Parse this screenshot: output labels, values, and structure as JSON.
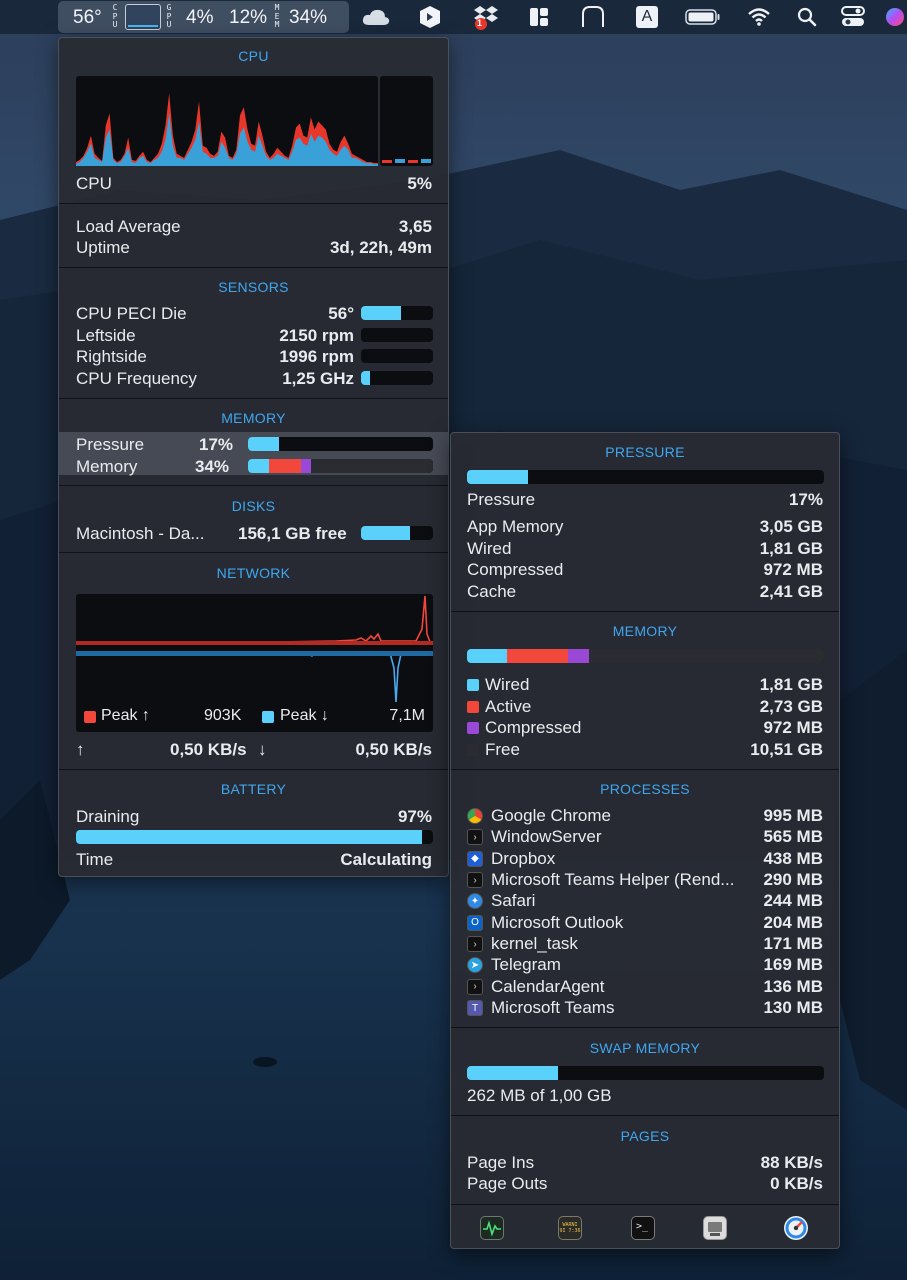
{
  "menubar": {
    "temperature": "56°",
    "cpu_vert_label": "C\nP\nU",
    "gpu_vert_label": "G\nP\nU",
    "gpu_percent": "4%",
    "cpu_percent": "12%",
    "mem_vert_label": "M\nE\nM",
    "mem_percent": "34%",
    "icons": [
      "cloud-icon",
      "dropzone-icon",
      "dropbox-icon",
      "rectangle-layout-icon",
      "dock-tab-icon",
      "input-source-icon",
      "battery-icon",
      "wifi-icon",
      "spotlight-search-icon",
      "control-center-icon",
      "siri-icon"
    ],
    "input_source_letter": "A",
    "badge_count": "1"
  },
  "cpu": {
    "title": "CPU",
    "label": "CPU",
    "value": "5%",
    "load_average_label": "Load Average",
    "load_average": "3,65",
    "uptime_label": "Uptime",
    "uptime": "3d, 22h, 49m",
    "graph_series": {
      "system": [
        4,
        6,
        10,
        18,
        30,
        12,
        8,
        5,
        40,
        52,
        8,
        4,
        6,
        12,
        28,
        6,
        5,
        10,
        14,
        6,
        4,
        8,
        12,
        22,
        40,
        72,
        30,
        12,
        10,
        8,
        16,
        24,
        36,
        64,
        20,
        18,
        12,
        10,
        14,
        34,
        28,
        10,
        8,
        16,
        50,
        58,
        36,
        22,
        20,
        44,
        30,
        14,
        8,
        12,
        18,
        14,
        10,
        8,
        20,
        38,
        42,
        30,
        28,
        48,
        36,
        44,
        40,
        36,
        22,
        16,
        14,
        24,
        30,
        22,
        12,
        10,
        8,
        6,
        4,
        4,
        3,
        3
      ],
      "user": [
        2,
        4,
        8,
        14,
        22,
        8,
        6,
        4,
        28,
        36,
        6,
        3,
        4,
        10,
        18,
        4,
        3,
        8,
        10,
        4,
        3,
        6,
        8,
        14,
        26,
        52,
        20,
        8,
        8,
        6,
        12,
        18,
        26,
        44,
        14,
        12,
        8,
        8,
        10,
        24,
        18,
        8,
        6,
        12,
        32,
        38,
        24,
        16,
        14,
        30,
        20,
        10,
        6,
        8,
        12,
        10,
        8,
        6,
        14,
        26,
        28,
        22,
        20,
        32,
        24,
        30,
        28,
        24,
        16,
        12,
        10,
        16,
        20,
        16,
        8,
        8,
        6,
        4,
        3,
        3,
        2,
        2
      ]
    }
  },
  "sensors": {
    "title": "SENSORS",
    "items": [
      {
        "label": "CPU PECI Die",
        "value": "56°",
        "fraction": 0.55
      },
      {
        "label": "Leftside",
        "value": "2150 rpm",
        "fraction": 0.0
      },
      {
        "label": "Rightside",
        "value": "1996 rpm",
        "fraction": 0.0
      },
      {
        "label": "CPU Frequency",
        "value": "1,25 GHz",
        "fraction": 0.12
      }
    ]
  },
  "memory_summary": {
    "title": "MEMORY",
    "pressure_label": "Pressure",
    "pressure_value": "17%",
    "pressure_fraction": 0.17,
    "memory_label": "Memory",
    "memory_value": "34%"
  },
  "disks": {
    "title": "DISKS",
    "name": "Macintosh - Da...",
    "free": "156,1 GB free",
    "used_fraction": 0.68
  },
  "network": {
    "title": "NETWORK",
    "peak_up_label": "Peak ↑",
    "peak_up_value": "903K",
    "peak_down_label": "Peak ↓",
    "peak_down_value": "7,1M",
    "up_arrow": "↑",
    "up_rate": "0,50 KB/s",
    "down_arrow": "↓",
    "down_rate": "0,50 KB/s"
  },
  "battery": {
    "title": "BATTERY",
    "status_label": "Draining",
    "percent": "97%",
    "fraction": 0.97,
    "time_label": "Time",
    "time_value": "Calculating"
  },
  "pressure": {
    "title": "PRESSURE",
    "fraction": 0.17,
    "label": "Pressure",
    "value": "17%",
    "rows": [
      {
        "label": "App Memory",
        "value": "3,05 GB"
      },
      {
        "label": "Wired",
        "value": "1,81 GB"
      },
      {
        "label": "Compressed",
        "value": "972 MB"
      },
      {
        "label": "Cache",
        "value": "2,41 GB"
      }
    ]
  },
  "memory_detail": {
    "title": "MEMORY",
    "rows": [
      {
        "label": "Wired",
        "value": "1,81 GB",
        "color": "#5ad1fb",
        "fraction": 0.113
      },
      {
        "label": "Active",
        "value": "2,73 GB",
        "color": "#f2473b",
        "fraction": 0.171
      },
      {
        "label": "Compressed",
        "value": "972 MB",
        "color": "#9a48d6",
        "fraction": 0.059
      },
      {
        "label": "Free",
        "value": "10,51 GB",
        "color": "#2a2c31",
        "fraction": 0.657
      }
    ]
  },
  "processes": {
    "title": "PROCESSES",
    "items": [
      {
        "name": "Google Chrome",
        "value": "995 MB",
        "icon": "chrome-icon"
      },
      {
        "name": "WindowServer",
        "value": "565 MB",
        "icon": "exec-icon"
      },
      {
        "name": "Dropbox",
        "value": "438 MB",
        "icon": "dropbox-icon"
      },
      {
        "name": "Microsoft Teams Helper (Rend...",
        "value": "290 MB",
        "icon": "exec-icon"
      },
      {
        "name": "Safari",
        "value": "244 MB",
        "icon": "safari-icon"
      },
      {
        "name": "Microsoft Outlook",
        "value": "204 MB",
        "icon": "outlook-icon"
      },
      {
        "name": "kernel_task",
        "value": "171 MB",
        "icon": "exec-icon"
      },
      {
        "name": "Telegram",
        "value": "169 MB",
        "icon": "telegram-icon"
      },
      {
        "name": "CalendarAgent",
        "value": "136 MB",
        "icon": "exec-icon"
      },
      {
        "name": "Microsoft Teams",
        "value": "130 MB",
        "icon": "teams-icon"
      }
    ]
  },
  "swap": {
    "title": "SWAP MEMORY",
    "fraction": 0.256,
    "text": "262 MB of 1,00 GB"
  },
  "pages": {
    "title": "PAGES",
    "ins_label": "Page Ins",
    "ins_value": "88 KB/s",
    "outs_label": "Page Outs",
    "outs_value": "0 KB/s"
  },
  "toolbar": {
    "icons": [
      "activity-monitor-icon",
      "console-icon",
      "terminal-icon",
      "system-information-icon",
      "istat-menus-icon"
    ],
    "console_badge": "WARNI\n9I 7:36"
  }
}
